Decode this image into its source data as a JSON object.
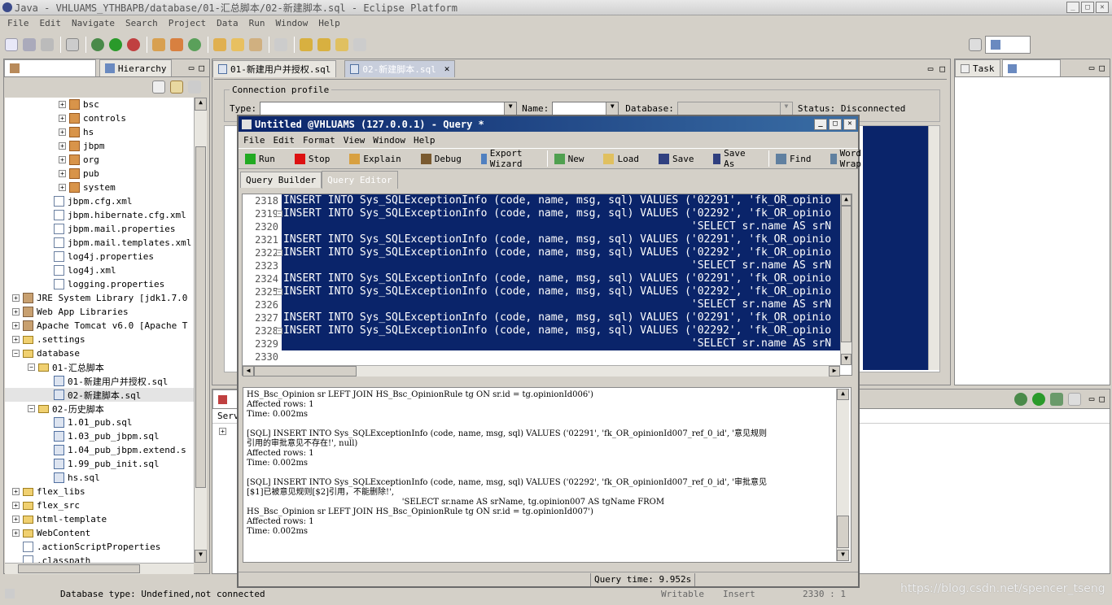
{
  "window": {
    "title": "Java - VHLUAMS_YTHBAPB/database/01-汇总脚本/02-新建脚本.sql - Eclipse Platform"
  },
  "menu": [
    "File",
    "Edit",
    "Navigate",
    "Search",
    "Project",
    "Data",
    "Run",
    "Window",
    "Help"
  ],
  "perspective": {
    "label": "Java"
  },
  "left_tabs": {
    "package_explorer": "Package Ex",
    "hierarchy": "Hierarchy"
  },
  "tree": [
    {
      "indent": 4,
      "exp": "+",
      "icon": "pkg",
      "label": "bsc"
    },
    {
      "indent": 4,
      "exp": "+",
      "icon": "pkg",
      "label": "controls"
    },
    {
      "indent": 4,
      "exp": "+",
      "icon": "pkg",
      "label": "hs"
    },
    {
      "indent": 4,
      "exp": "+",
      "icon": "pkg",
      "label": "jbpm"
    },
    {
      "indent": 4,
      "exp": "+",
      "icon": "pkg",
      "label": "org"
    },
    {
      "indent": 4,
      "exp": "+",
      "icon": "pkg",
      "label": "pub"
    },
    {
      "indent": 4,
      "exp": "+",
      "icon": "pkg",
      "label": "system"
    },
    {
      "indent": 3,
      "exp": "",
      "icon": "file",
      "label": "jbpm.cfg.xml"
    },
    {
      "indent": 3,
      "exp": "",
      "icon": "file",
      "label": "jbpm.hibernate.cfg.xml"
    },
    {
      "indent": 3,
      "exp": "",
      "icon": "file",
      "label": "jbpm.mail.properties"
    },
    {
      "indent": 3,
      "exp": "",
      "icon": "file",
      "label": "jbpm.mail.templates.xml"
    },
    {
      "indent": 3,
      "exp": "",
      "icon": "file",
      "label": "log4j.properties"
    },
    {
      "indent": 3,
      "exp": "",
      "icon": "file",
      "label": "log4j.xml"
    },
    {
      "indent": 3,
      "exp": "",
      "icon": "file",
      "label": "logging.properties"
    },
    {
      "indent": 1,
      "exp": "+",
      "icon": "lib",
      "label": "JRE System Library [jdk1.7.0"
    },
    {
      "indent": 1,
      "exp": "+",
      "icon": "lib",
      "label": "Web App Libraries"
    },
    {
      "indent": 1,
      "exp": "+",
      "icon": "lib",
      "label": "Apache Tomcat v6.0 [Apache T"
    },
    {
      "indent": 1,
      "exp": "+",
      "icon": "folder",
      "label": ".settings"
    },
    {
      "indent": 1,
      "exp": "−",
      "icon": "folder",
      "label": "database"
    },
    {
      "indent": 2,
      "exp": "−",
      "icon": "folder",
      "label": "01-汇总脚本"
    },
    {
      "indent": 3,
      "exp": "",
      "icon": "sql",
      "label": "01-新建用户并授权.sql"
    },
    {
      "indent": 3,
      "exp": "",
      "icon": "sql",
      "label": "02-新建脚本.sql"
    },
    {
      "indent": 2,
      "exp": "−",
      "icon": "folder",
      "label": "02-历史脚本"
    },
    {
      "indent": 3,
      "exp": "",
      "icon": "sql",
      "label": "1.01_pub.sql"
    },
    {
      "indent": 3,
      "exp": "",
      "icon": "sql",
      "label": "1.03_pub_jbpm.sql"
    },
    {
      "indent": 3,
      "exp": "",
      "icon": "sql",
      "label": "1.04_pub_jbpm.extend.s"
    },
    {
      "indent": 3,
      "exp": "",
      "icon": "sql",
      "label": "1.99_pub_init.sql"
    },
    {
      "indent": 3,
      "exp": "",
      "icon": "sql",
      "label": "hs.sql"
    },
    {
      "indent": 1,
      "exp": "+",
      "icon": "folder",
      "label": "flex_libs"
    },
    {
      "indent": 1,
      "exp": "+",
      "icon": "folder",
      "label": "flex_src"
    },
    {
      "indent": 1,
      "exp": "+",
      "icon": "folder",
      "label": "html-template"
    },
    {
      "indent": 1,
      "exp": "+",
      "icon": "folder",
      "label": "WebContent"
    },
    {
      "indent": 1,
      "exp": "",
      "icon": "file",
      "label": ".actionScriptProperties"
    },
    {
      "indent": 1,
      "exp": "",
      "icon": "file",
      "label": ".classpath"
    }
  ],
  "editor_tabs": [
    "01-新建用户并授权.sql",
    "02-新建脚本.sql"
  ],
  "conn": {
    "section": "Connection profile",
    "type": "Type:",
    "name": "Name:",
    "database": "Database:",
    "status": "Status: Disconnected"
  },
  "right_tabs": {
    "task": "Task",
    "outline": "Outl"
  },
  "bottom_tab": {
    "prefix": "P",
    "server": "Serv"
  },
  "sql": {
    "title": "Untitled @VHLUAMS (127.0.0.1) - Query *",
    "menu": [
      "File",
      "Edit",
      "Format",
      "View",
      "Window",
      "Help"
    ],
    "toolbar": [
      {
        "label": "Run",
        "color": "#22aa22"
      },
      {
        "label": "Stop",
        "color": "#dd1111"
      },
      {
        "label": "Explain",
        "color": "#d8a040"
      },
      {
        "label": "Debug",
        "color": "#7a5a30"
      },
      {
        "label": "Export Wizard",
        "color": "#5080c0"
      },
      {
        "label": "New",
        "color": "#50a050"
      },
      {
        "label": "Load",
        "color": "#e0c060"
      },
      {
        "label": "Save",
        "color": "#304080"
      },
      {
        "label": "Save As",
        "color": "#304080"
      },
      {
        "label": "Find",
        "color": "#6080a0"
      },
      {
        "label": "Word Wrap",
        "color": "#6080a0"
      }
    ],
    "tabs": [
      "Query Builder",
      "Query Editor"
    ],
    "lines": [
      {
        "n": "2318",
        "fold": false,
        "text": "INSERT INTO Sys_SQLExceptionInfo (code, name, msg, sql) VALUES ('02291', 'fk_OR_opinio"
      },
      {
        "n": "2319",
        "fold": true,
        "text": "INSERT INTO Sys_SQLExceptionInfo (code, name, msg, sql) VALUES ('02292', 'fk_OR_opinio"
      },
      {
        "n": "2320",
        "fold": false,
        "text": "                                                                'SELECT sr.name AS srN"
      },
      {
        "n": "2321",
        "fold": false,
        "text": "INSERT INTO Sys_SQLExceptionInfo (code, name, msg, sql) VALUES ('02291', 'fk_OR_opinio"
      },
      {
        "n": "2322",
        "fold": true,
        "text": "INSERT INTO Sys_SQLExceptionInfo (code, name, msg, sql) VALUES ('02292', 'fk_OR_opinio"
      },
      {
        "n": "2323",
        "fold": false,
        "text": "                                                                'SELECT sr.name AS srN"
      },
      {
        "n": "2324",
        "fold": false,
        "text": "INSERT INTO Sys_SQLExceptionInfo (code, name, msg, sql) VALUES ('02291', 'fk_OR_opinio"
      },
      {
        "n": "2325",
        "fold": true,
        "text": "INSERT INTO Sys_SQLExceptionInfo (code, name, msg, sql) VALUES ('02292', 'fk_OR_opinio"
      },
      {
        "n": "2326",
        "fold": false,
        "text": "                                                                'SELECT sr.name AS srN"
      },
      {
        "n": "2327",
        "fold": false,
        "text": "INSERT INTO Sys_SQLExceptionInfo (code, name, msg, sql) VALUES ('02291', 'fk_OR_opinio"
      },
      {
        "n": "2328",
        "fold": true,
        "text": "INSERT INTO Sys_SQLExceptionInfo (code, name, msg, sql) VALUES ('02292', 'fk_OR_opinio"
      },
      {
        "n": "2329",
        "fold": false,
        "text": "                                                                'SELECT sr.name AS srN"
      },
      {
        "n": "2330",
        "fold": false,
        "text": ""
      }
    ],
    "output": "HS_Bsc_Opinion sr LEFT JOIN HS_Bsc_OpinionRule tg ON sr.id = tg.opinionId006')\nAffected rows: 1\nTime: 0.002ms\n\n[SQL] INSERT INTO Sys_SQLExceptionInfo (code, name, msg, sql) VALUES ('02291', 'fk_OR_opinionId007_ref_0_id', '意见规则\n引用的审批意见不存在!', null)\nAffected rows: 1\nTime: 0.002ms\n\n[SQL] INSERT INTO Sys_SQLExceptionInfo (code, name, msg, sql) VALUES ('02292', 'fk_OR_opinionId007_ref_0_id', '审批意见\n[$1]已被意见规则[$2]引用，不能删除!',\n                                                            'SELECT sr.name AS srName, tg.opinion007 AS tgName FROM\nHS_Bsc_Opinion sr LEFT JOIN HS_Bsc_OpinionRule tg ON sr.id = tg.opinionId007')\nAffected rows: 1\nTime: 0.002ms",
    "query_time": "Query time: 9.952s"
  },
  "status": {
    "db": "Database type: Undefined,not connected",
    "writable": "Writable",
    "insert": "Insert",
    "pos": "2330 : 1",
    "watermark": "https://blog.csdn.net/spencer_tseng"
  }
}
